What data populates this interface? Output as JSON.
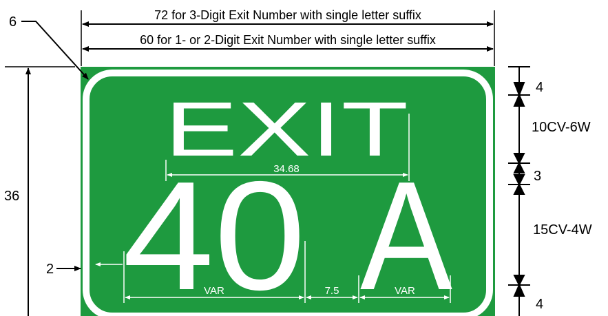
{
  "colors": {
    "sign_green": "#1e9a3f",
    "border_white": "#ffffff",
    "dimension_line": "#000000",
    "background": "#ffffff"
  },
  "sign": {
    "line1": "EXIT",
    "exit_number": "40",
    "suffix": "A"
  },
  "top_dimensions": {
    "width_3digit": "72 for 3-Digit Exit Number with single letter suffix",
    "width_1_2digit": "60 for 1- or 2-Digit Exit Number with single letter suffix"
  },
  "left_dimensions": {
    "corner_radius": "6",
    "height": "36",
    "border_margin": "2"
  },
  "right_dimensions": {
    "top_margin": "4",
    "exit_letter_spec": "10CV-6W",
    "line_gap": "3",
    "number_spec": "15CV-4W",
    "bottom_margin": "4"
  },
  "internal_dimensions": {
    "exit_word_width": "34.68",
    "number_width": "VAR",
    "number_suffix_gap": "7.5",
    "suffix_width": "VAR"
  }
}
